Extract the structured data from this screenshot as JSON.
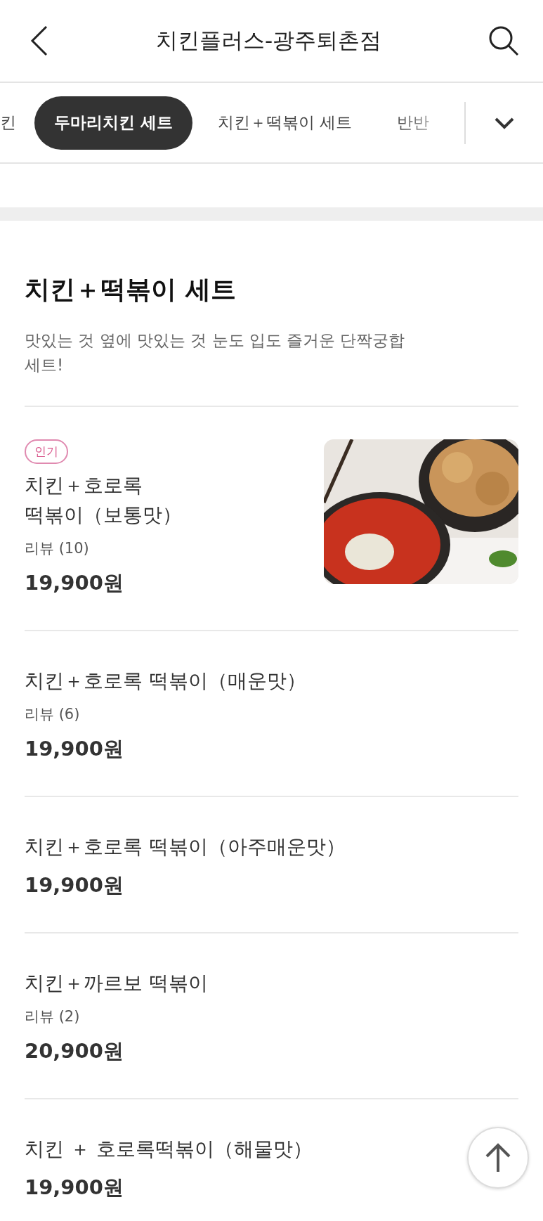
{
  "header": {
    "title": "치킨플러스-광주퇴촌점"
  },
  "tabs": [
    {
      "label": "킨",
      "selected": false
    },
    {
      "label": "두마리치킨 세트",
      "selected": true
    },
    {
      "label": "치킨＋떡볶이 세트",
      "selected": false
    },
    {
      "label": "반반",
      "selected": false
    }
  ],
  "section": {
    "title": "치킨＋떡볶이 세트",
    "description": "맛있는 것 옆에 맛있는 것 눈도 입도 즐거운 단짝궁합 세트!",
    "items": [
      {
        "badge": "인기",
        "name": "치킨＋호로록 떡볶이（보통맛）",
        "review": "리뷰 (10)",
        "price": "19,900원"
      },
      {
        "name": "치킨＋호로록 떡볶이（매운맛）",
        "review": "리뷰 (6)",
        "price": "19,900원"
      },
      {
        "name": "치킨＋호로록 떡볶이（아주매운맛）",
        "price": "19,900원"
      },
      {
        "name": "치킨＋까르보 떡볶이",
        "review": "리뷰 (2)",
        "price": "20,900원"
      },
      {
        "name": "치킨 ＋ 호로록떡볶이（해물맛）",
        "price": "19,900원"
      }
    ]
  }
}
